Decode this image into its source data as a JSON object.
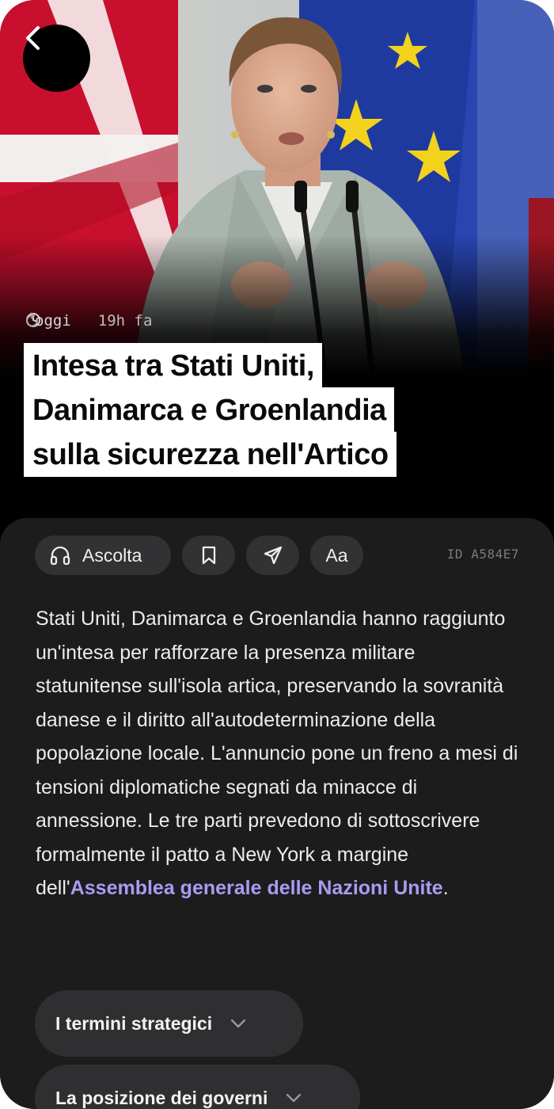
{
  "meta": {
    "date_label": "oggi",
    "updated_label": "19h fa"
  },
  "headline": {
    "lines": [
      "Intesa tra Stati Uniti,",
      "Danimarca e Groenlandia",
      "sulla sicurezza nell'Artico"
    ]
  },
  "toolbar": {
    "listen_label": "Ascolta",
    "font_label": "Aa",
    "article_id": "ID A584E7"
  },
  "article": {
    "body_text": "Stati Uniti, Danimarca e Groenlandia hanno raggiunto un'intesa per rafforzare la presenza militare statunitense sull'isola artica, preservando la sovranità danese e il diritto all'autodeterminazione della popolazione locale. L'annuncio pone un freno a mesi di tensioni diplomatiche segnati da minacce di annessione. Le tre parti prevedono di sottoscrivere formalmente il patto a New York a margine dell'",
    "link_text": "Assemblea generale delle Nazioni Unite",
    "end_text": "."
  },
  "sections": [
    {
      "label": "I termini strategici"
    },
    {
      "label": "La posizione dei governi"
    }
  ],
  "icons": {
    "back": "chevron-left-icon",
    "clock": "clock-icon",
    "refresh": "refresh-icon",
    "headphones": "headphones-icon",
    "bookmark": "bookmark-icon",
    "share": "send-icon",
    "chevron": "chevron-down-icon"
  },
  "colors": {
    "link": "#a99cf2",
    "sheet": "#1c1c1d",
    "pill": "#323234"
  }
}
